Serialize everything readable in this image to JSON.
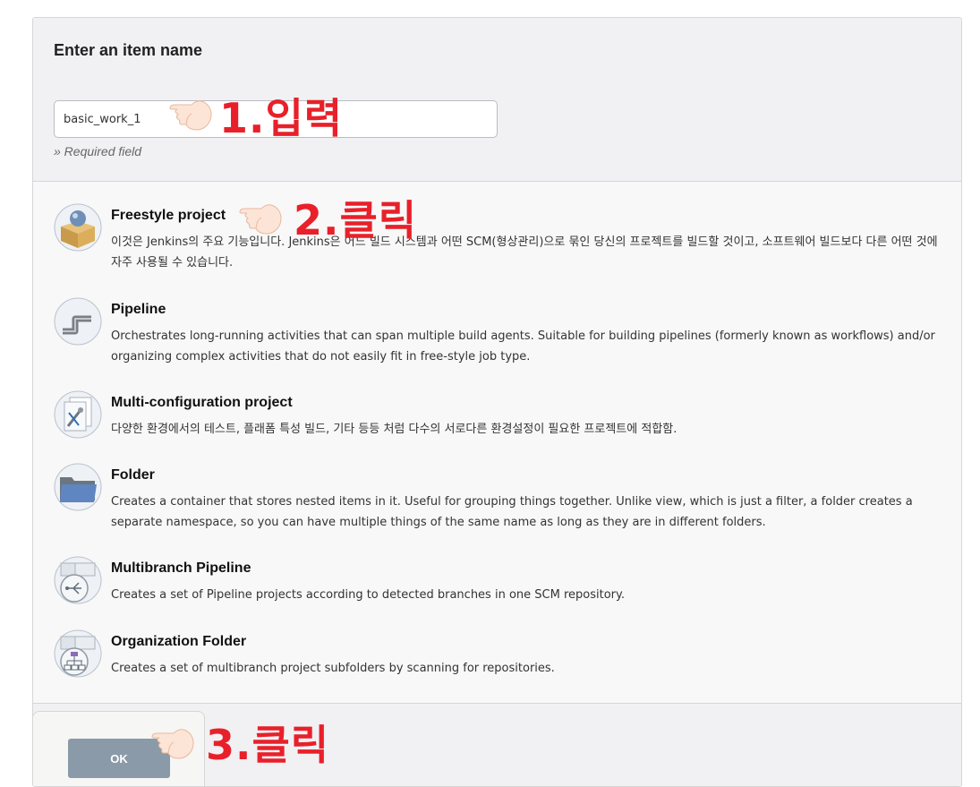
{
  "form": {
    "title": "Enter an item name",
    "input_value": "basic_work_1",
    "required_text": "» Required field"
  },
  "items": [
    {
      "title": "Freestyle project",
      "desc": "이것은 Jenkins의 주요 기능입니다. Jenkins은 어느 빌드 시스템과 어떤 SCM(형상관리)으로 묶인 당신의 프로젝트를 빌드할 것이고, 소프트웨어 빌드보다 다른 어떤 것에 자주 사용될 수 있습니다.",
      "icon": "freestyle-box-icon"
    },
    {
      "title": "Pipeline",
      "desc": "Orchestrates long-running activities that can span multiple build agents. Suitable for building pipelines (formerly known as workflows) and/or organizing complex activities that do not easily fit in free-style job type.",
      "icon": "pipe-icon"
    },
    {
      "title": "Multi-configuration project",
      "desc": "다양한 환경에서의 테스트, 플래폼 특성 빌드, 기타 등등 처럼 다수의 서로다른 환경설정이 필요한 프로젝트에 적합함.",
      "icon": "multi-config-icon"
    },
    {
      "title": "Folder",
      "desc": "Creates a container that stores nested items in it. Useful for grouping things together. Unlike view, which is just a filter, a folder creates a separate namespace, so you can have multiple things of the same name as long as they are in different folders.",
      "icon": "folder-icon"
    },
    {
      "title": "Multibranch Pipeline",
      "desc": "Creates a set of Pipeline projects according to detected branches in one SCM repository.",
      "icon": "multibranch-icon"
    },
    {
      "title": "Organization Folder",
      "desc": "Creates a set of multibranch project subfolders by scanning for repositories.",
      "icon": "organization-folder-icon"
    }
  ],
  "ok_label": "OK",
  "annotations": {
    "step1": "1.입력",
    "step2": "2.클릭",
    "step3": "3.클릭"
  },
  "colors": {
    "annotation": "#e8202a",
    "ok_button": "#8a9aa8"
  }
}
